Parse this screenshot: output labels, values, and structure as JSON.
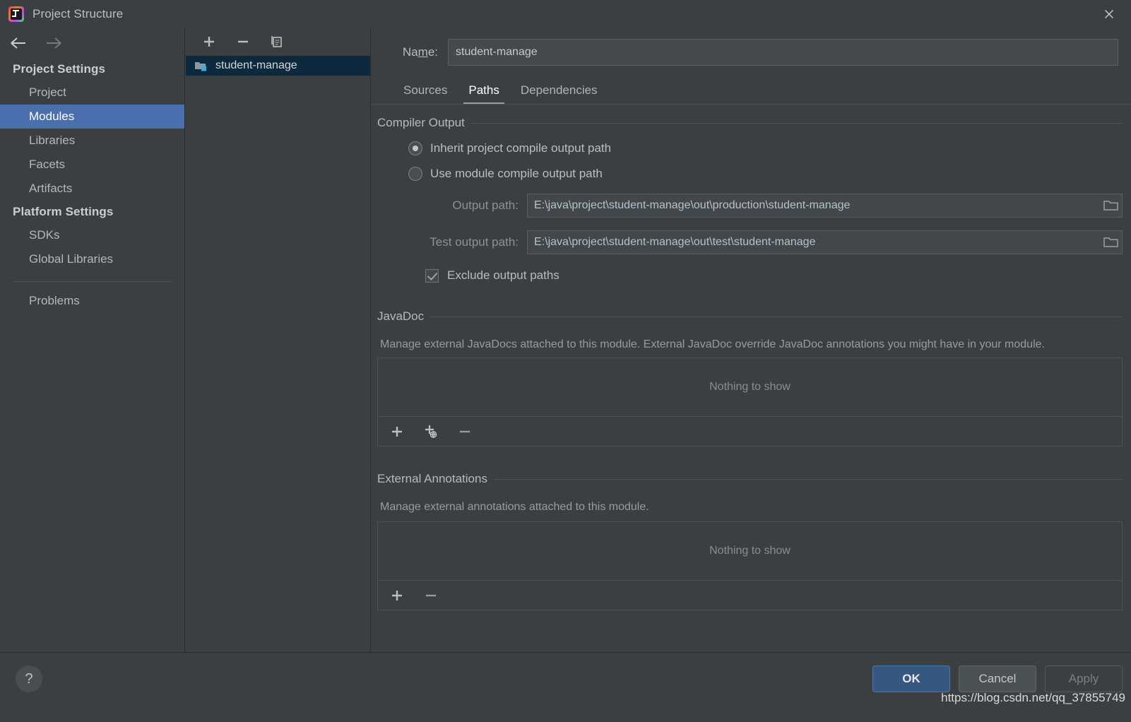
{
  "window": {
    "title": "Project Structure",
    "logo_icon": "intellij-idea-logo",
    "close_icon": "close-icon"
  },
  "sidebar": {
    "back_icon": "arrow-left-icon",
    "forward_icon": "arrow-right-icon",
    "groups": [
      {
        "title": "Project Settings",
        "items": [
          {
            "label": "Project",
            "selected": false
          },
          {
            "label": "Modules",
            "selected": true
          },
          {
            "label": "Libraries",
            "selected": false
          },
          {
            "label": "Facets",
            "selected": false
          },
          {
            "label": "Artifacts",
            "selected": false
          }
        ]
      },
      {
        "title": "Platform Settings",
        "items": [
          {
            "label": "SDKs",
            "selected": false
          },
          {
            "label": "Global Libraries",
            "selected": false
          }
        ]
      }
    ],
    "problems_label": "Problems"
  },
  "module_pane": {
    "toolbar": [
      {
        "name": "add-module-button",
        "icon": "plus-icon"
      },
      {
        "name": "remove-module-button",
        "icon": "minus-icon"
      },
      {
        "name": "copy-module-button",
        "icon": "copy-icon"
      }
    ],
    "modules": [
      {
        "label": "student-manage",
        "icon": "module-folder-icon",
        "selected": true
      }
    ]
  },
  "main": {
    "name_label_prefix": "Na",
    "name_label_mnemonic": "m",
    "name_label_suffix": "e:",
    "name_value": "student-manage",
    "tabs": [
      {
        "label": "Sources",
        "active": false
      },
      {
        "label": "Paths",
        "active": true
      },
      {
        "label": "Dependencies",
        "active": false
      }
    ],
    "compiler_output": {
      "title": "Compiler Output",
      "radio_inherit": "Inherit project compile output path",
      "radio_module": "Use module compile output path",
      "selected_radio": "inherit",
      "output_path_label": "Output path:",
      "output_path_value": "E:\\java\\project\\student-manage\\out\\production\\student-manage",
      "test_output_path_label": "Test output path:",
      "test_output_path_value": "E:\\java\\project\\student-manage\\out\\test\\student-manage",
      "browse_icon": "folder-browse-icon",
      "exclude_label": "Exclude output paths",
      "exclude_checked": true
    },
    "javadoc": {
      "title": "JavaDoc",
      "description": "Manage external JavaDocs attached to this module. External JavaDoc override JavaDoc annotations you might have in your module.",
      "empty_text": "Nothing to show",
      "toolbar": [
        {
          "name": "add-javadoc-button",
          "icon": "plus-icon"
        },
        {
          "name": "add-javadoc-url-button",
          "icon": "plus-globe-icon"
        },
        {
          "name": "remove-javadoc-button",
          "icon": "minus-icon"
        }
      ]
    },
    "external_annotations": {
      "title": "External Annotations",
      "description": "Manage external annotations attached to this module.",
      "empty_text": "Nothing to show",
      "toolbar": [
        {
          "name": "add-annotation-button",
          "icon": "plus-icon"
        },
        {
          "name": "remove-annotation-button",
          "icon": "minus-icon"
        }
      ]
    }
  },
  "footer": {
    "help_icon": "question-mark-icon",
    "ok_label": "OK",
    "cancel_label": "Cancel",
    "apply_label": "Apply",
    "apply_enabled": false
  },
  "watermark": {
    "text": "https://blog.csdn.net/qq_37855749"
  },
  "colors": {
    "window_bg": "#3c3f41",
    "selection_blue": "#4b6eaf",
    "tree_selection": "#0d293e",
    "primary_button": "#365880",
    "path_text": "#b3c2cc",
    "badge_cyan": "#3dade0"
  }
}
